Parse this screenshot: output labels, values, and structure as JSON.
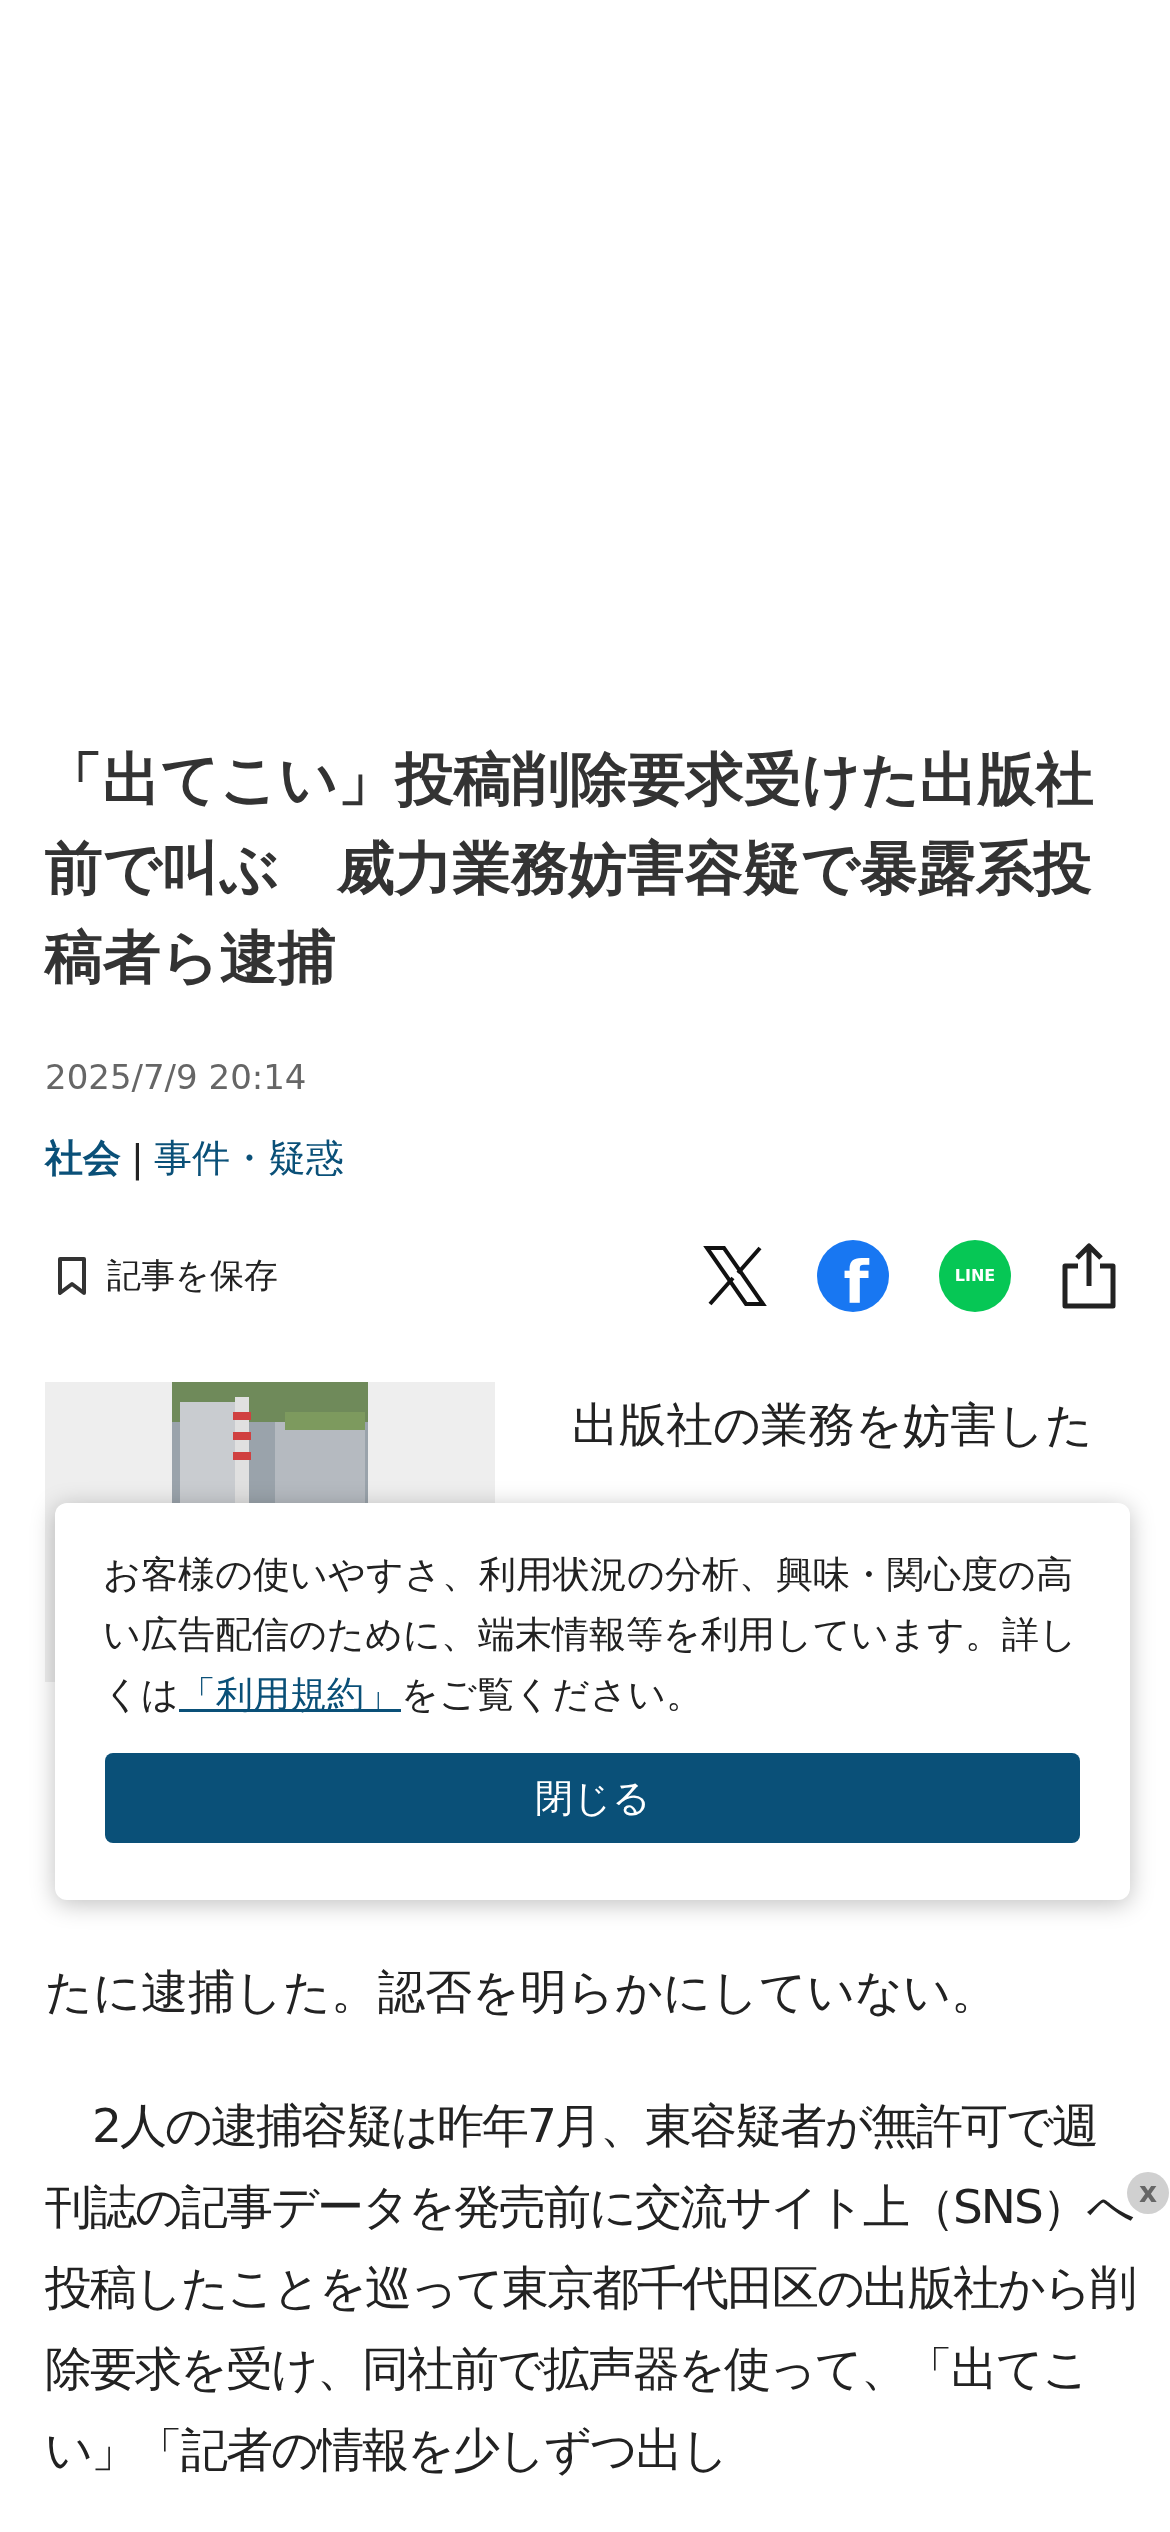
{
  "article": {
    "title": "「出てこい」投稿削除要求受けた出版社前で叫ぶ　威力業務妨害容疑で暴露系投稿者ら逮捕",
    "date": "2025/7/9 20:14",
    "categories": [
      {
        "label": "社会",
        "selected": true
      },
      {
        "label": "事件・疑惑",
        "selected": false
      }
    ],
    "category_separator": "|",
    "save_label": "記事を保存",
    "lead": "出版社の業務を妨害した",
    "paragraphs": [
      "たに逮捕した。認否を明らかにしていない。",
      "2人の逮捕容疑は昨年7月、東容疑者が無許可で週刊誌の記事データを発売前に交流サイト上（SNS）へ投稿したことを巡って東京都千代田区の出版社から削除要求を受け、同社前で拡声器を使って、「出てこい」「記者の情報を少しずつ出し"
    ]
  },
  "share_buttons": [
    {
      "kind": "x"
    },
    {
      "kind": "facebook",
      "label": "f"
    },
    {
      "kind": "line",
      "label": "LINE"
    },
    {
      "kind": "share"
    }
  ],
  "cookie_notice": {
    "text_before": "お客様の使いやすさ、利用状況の分析、興味・関心度の高い広告配信のために、端末情報等を利用しています。詳しくは",
    "link": "「利用規約」",
    "text_after": "をご覧ください。",
    "button": "閉じる"
  },
  "ad_close": "x"
}
